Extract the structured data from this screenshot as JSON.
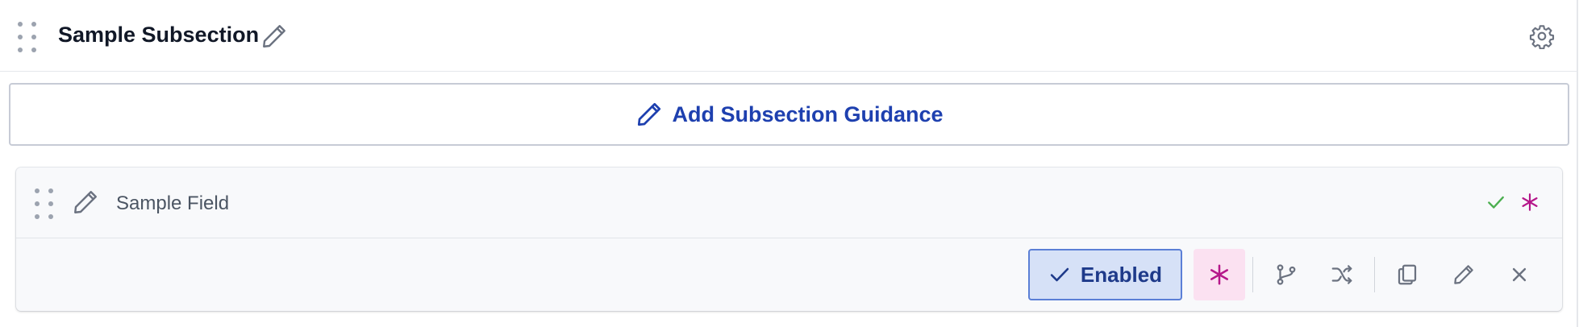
{
  "subsection": {
    "title": "Sample Subsection",
    "edit_icon": "pencil-icon",
    "settings_icon": "gear-icon"
  },
  "guidance": {
    "label": "Add Subsection Guidance",
    "icon": "pencil-icon"
  },
  "field": {
    "name": "Sample Field",
    "status_icons": [
      "check-icon",
      "asterisk-icon"
    ],
    "toolbar": {
      "enabled_label": "Enabled",
      "required_icon": "asterisk-icon",
      "tools": [
        "branch-icon",
        "shuffle-icon",
        "copy-icon",
        "pencil-icon",
        "close-icon"
      ]
    }
  },
  "colors": {
    "accent": "#1e40af",
    "enabled_bg": "#d6e1f7",
    "enabled_border": "#5b7fd6",
    "required_bg": "#fbe1f1",
    "required_color": "#b5178a",
    "success": "#4caf50",
    "icon_gray": "#6b7280"
  }
}
